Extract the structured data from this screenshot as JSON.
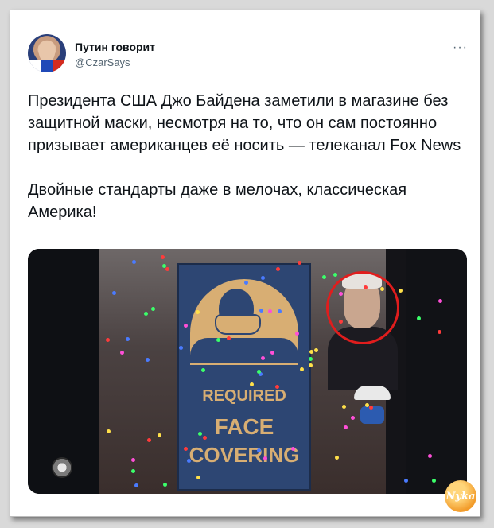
{
  "tweet": {
    "author_name": "Путин говорит",
    "handle": "@CzarSays",
    "more_icon": "more-horizontal-icon",
    "text": "Президента США Джо Байдена заметили в магазине без защитной маски, несмотря на то, что он сам постоянно призывает американцев её носить — телеканал Fox News\n\nДвойные стандарты даже в мелочах, классическая Америка!"
  },
  "media": {
    "sign_line_1": "REQUIRED",
    "sign_line_2": "FACE",
    "sign_line_3": "COVERING",
    "highlight_color": "#e01d1d",
    "sign_color": "#2d4673",
    "sign_accent": "#d8ae73"
  },
  "watermark": {
    "text": "Nyka"
  }
}
